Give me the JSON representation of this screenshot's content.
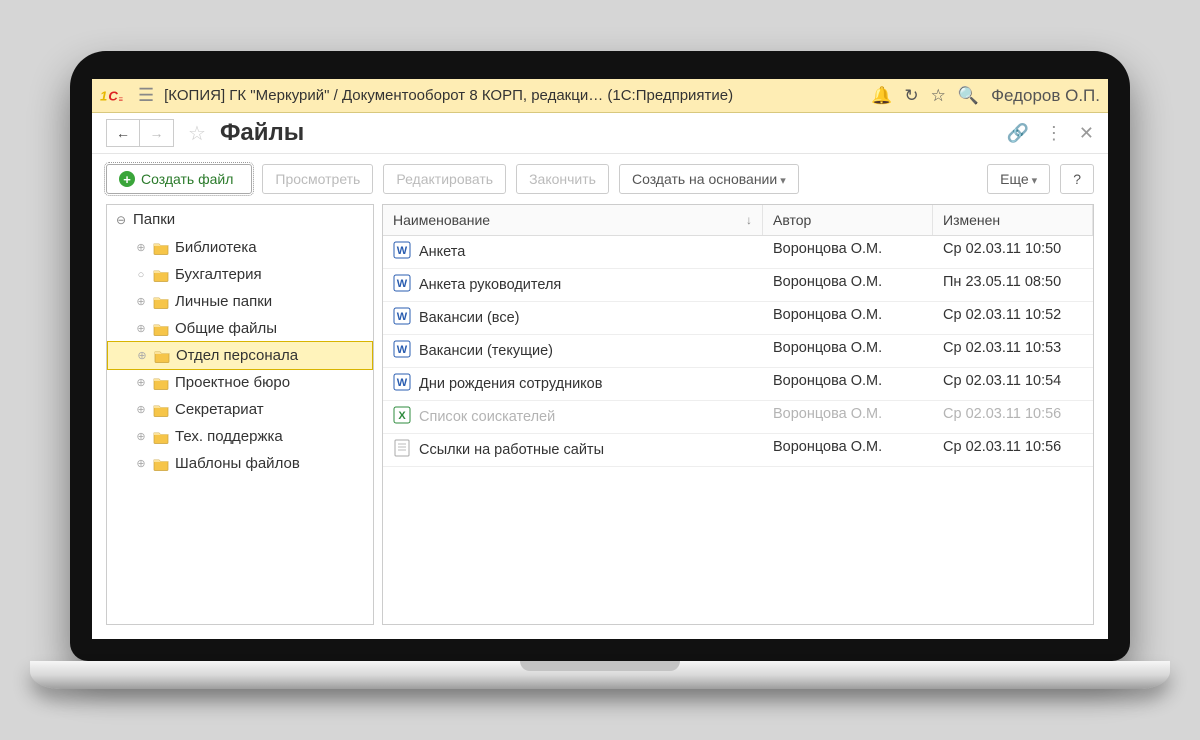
{
  "titlebar": {
    "title": "[КОПИЯ] ГК \"Меркурий\" / Документооборот 8 КОРП, редакци…   (1С:Предприятие)",
    "user": "Федоров О.П."
  },
  "window": {
    "title": "Файлы"
  },
  "toolbar": {
    "create_file": "Создать файл",
    "view": "Просмотреть",
    "edit": "Редактировать",
    "finish": "Закончить",
    "create_based_on": "Создать на основании",
    "more": "Еще",
    "help": "?"
  },
  "tree": {
    "root": "Папки",
    "items": [
      {
        "label": "Библиотека",
        "selected": false,
        "exp": "⊕"
      },
      {
        "label": "Бухгалтерия",
        "selected": false,
        "exp": "○"
      },
      {
        "label": "Личные папки",
        "selected": false,
        "exp": "⊕"
      },
      {
        "label": "Общие файлы",
        "selected": false,
        "exp": "⊕"
      },
      {
        "label": "Отдел персонала",
        "selected": true,
        "exp": "⊕"
      },
      {
        "label": "Проектное бюро",
        "selected": false,
        "exp": "⊕"
      },
      {
        "label": "Секретариат",
        "selected": false,
        "exp": "⊕"
      },
      {
        "label": "Тех. поддержка",
        "selected": false,
        "exp": "⊕"
      },
      {
        "label": "Шаблоны файлов",
        "selected": false,
        "exp": "⊕"
      }
    ]
  },
  "files": {
    "columns": {
      "name": "Наименование",
      "author": "Автор",
      "modified": "Изменен"
    },
    "rows": [
      {
        "icon": "word",
        "name": "Анкета",
        "author": "Воронцова О.М.",
        "modified": "Ср 02.03.11 10:50",
        "dim": false
      },
      {
        "icon": "word",
        "name": "Анкета руководителя",
        "author": "Воронцова О.М.",
        "modified": "Пн 23.05.11 08:50",
        "dim": false
      },
      {
        "icon": "word",
        "name": "Вакансии (все)",
        "author": "Воронцова О.М.",
        "modified": "Ср 02.03.11 10:52",
        "dim": false
      },
      {
        "icon": "word",
        "name": "Вакансии (текущие)",
        "author": "Воронцова О.М.",
        "modified": "Ср 02.03.11 10:53",
        "dim": false
      },
      {
        "icon": "word",
        "name": "Дни рождения сотрудников",
        "author": "Воронцова О.М.",
        "modified": "Ср 02.03.11 10:54",
        "dim": false
      },
      {
        "icon": "excel",
        "name": "Список соискателей",
        "author": "Воронцова О.М.",
        "modified": "Ср 02.03.11 10:56",
        "dim": true
      },
      {
        "icon": "text",
        "name": "Ссылки на работные сайты",
        "author": "Воронцова О.М.",
        "modified": "Ср 02.03.11 10:56",
        "dim": false
      }
    ]
  }
}
